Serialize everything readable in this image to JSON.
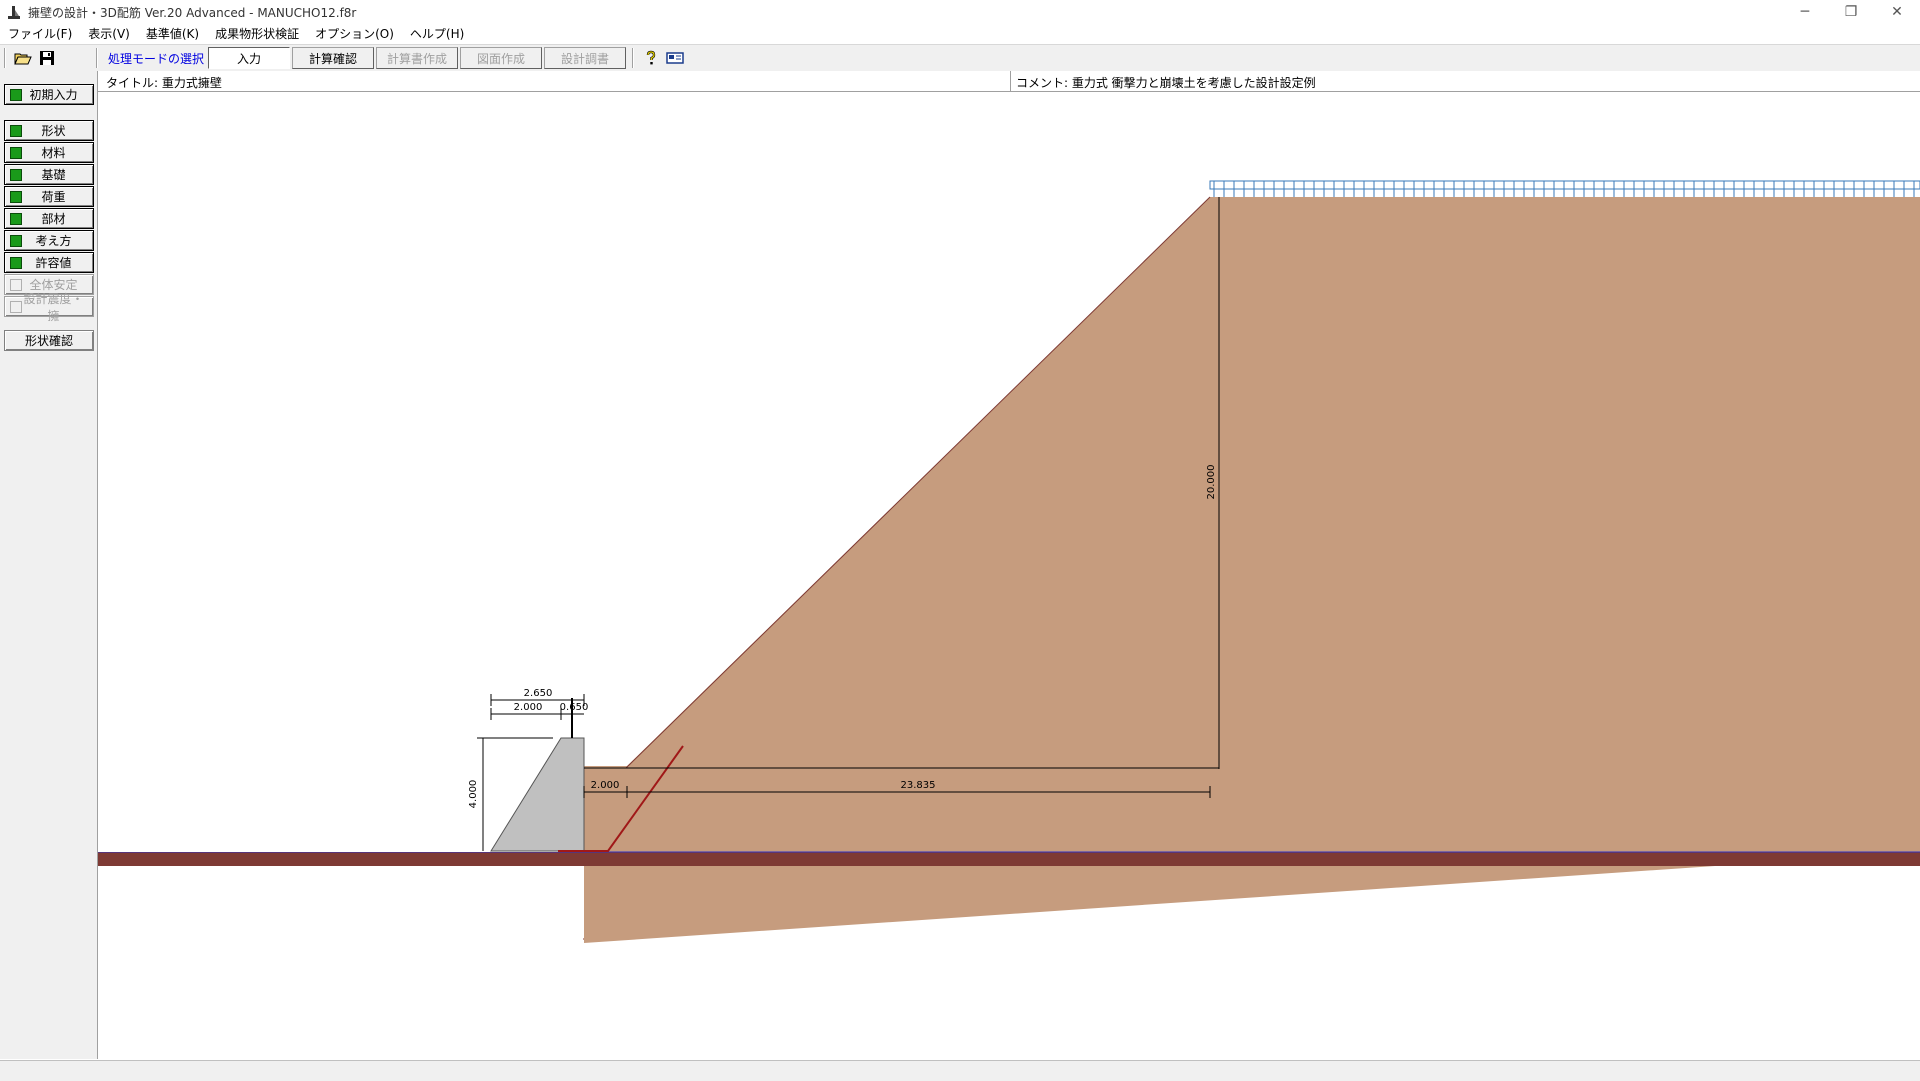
{
  "window": {
    "title": "擁壁の設計・3D配筋 Ver.20 Advanced  - MANUCHO12.f8r",
    "minimize": "─",
    "restore": "❐",
    "close": "✕"
  },
  "menu": [
    "ファイル(F)",
    "表示(V)",
    "基準値(K)",
    "成果物形状検証",
    "オプション(O)",
    "ヘルプ(H)"
  ],
  "toolbar": {
    "open_icon": "folder-open-icon",
    "save_icon": "save-disk-icon",
    "mode_label": "処理モードの選択",
    "modes": [
      {
        "label": "入力",
        "state": "active"
      },
      {
        "label": "計算確認",
        "state": "normal"
      },
      {
        "label": "計算書作成",
        "state": "disabled"
      },
      {
        "label": "図面作成",
        "state": "disabled"
      },
      {
        "label": "設計調書",
        "state": "disabled"
      }
    ],
    "help_icon": "help-question-icon",
    "info_icon": "info-card-icon"
  },
  "sidebar": {
    "initial": "初期入力",
    "items": [
      {
        "label": "形状",
        "checked": true,
        "enabled": true
      },
      {
        "label": "材料",
        "checked": true,
        "enabled": true
      },
      {
        "label": "基礎",
        "checked": true,
        "enabled": true
      },
      {
        "label": "荷重",
        "checked": true,
        "enabled": true
      },
      {
        "label": "部材",
        "checked": true,
        "enabled": true
      },
      {
        "label": "考え方",
        "checked": true,
        "enabled": true
      },
      {
        "label": "許容値",
        "checked": true,
        "enabled": true
      },
      {
        "label": "全体安定",
        "checked": false,
        "enabled": false
      },
      {
        "label": "設計震度・擁",
        "checked": false,
        "enabled": false
      }
    ],
    "shape_check": "形状確認"
  },
  "info": {
    "title": "タイトル:  重力式擁壁",
    "comment": "コメント:  重力式 衝撃力と崩壊土を考慮した設計設定例"
  },
  "drawing": {
    "dims": {
      "top_total": "2.650",
      "top_base": "2.000",
      "top_crown": "0.650",
      "wall_height": "4.000",
      "slope_height": "20.000",
      "gap_width": "2.000",
      "slope_width": "23.835"
    },
    "colors": {
      "soil": "#c69c7e",
      "ground": "#7e3a34",
      "wall": "#c0c0c0",
      "load": "#3a7ab8"
    }
  }
}
